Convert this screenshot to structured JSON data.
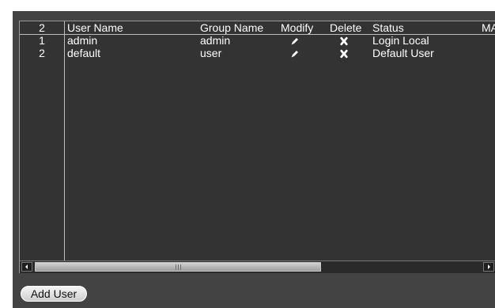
{
  "table": {
    "columns": {
      "index": "2",
      "user_name": "User Name",
      "group_name": "Group Name",
      "modify": "Modify",
      "delete": "Delete",
      "status": "Status",
      "mac": "MA"
    },
    "rows": [
      {
        "index": "1",
        "user_name": "admin",
        "group_name": "admin",
        "modify_icon": "edit-icon",
        "delete_icon": "delete-icon",
        "status": "Login Local"
      },
      {
        "index": "2",
        "user_name": "default",
        "group_name": "user",
        "modify_icon": "edit-icon",
        "delete_icon": "delete-icon",
        "status": "Default User"
      }
    ]
  },
  "actions": {
    "add_user_label": "Add User"
  },
  "colors": {
    "panel": "#434343",
    "table_background": "#333333",
    "text": "#ffffff",
    "button_background": "#e6e6e6"
  }
}
